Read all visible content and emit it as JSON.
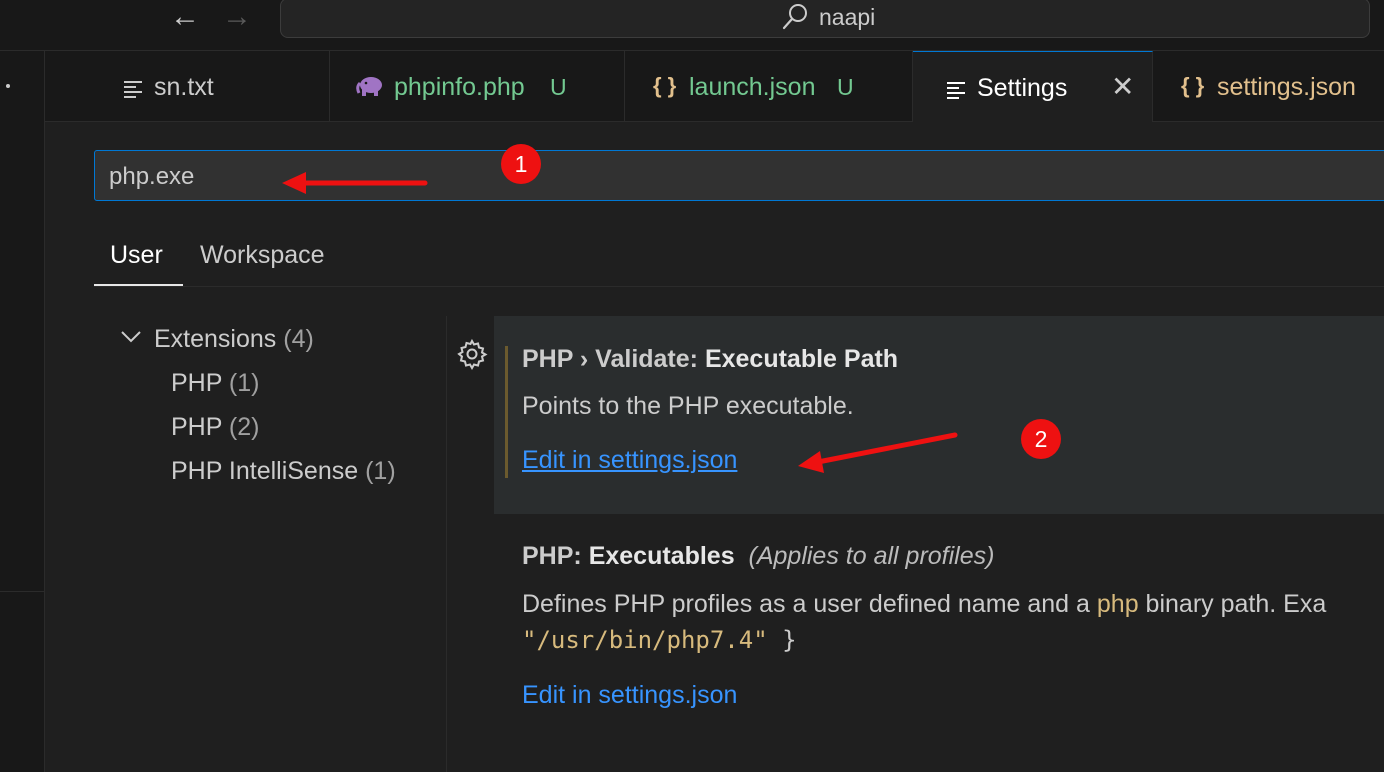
{
  "window": {
    "search_text": "naapi"
  },
  "tabs": [
    {
      "label": "sn.txt",
      "icon": "lines-icon",
      "color": "#cccccc"
    },
    {
      "label": "phpinfo.php",
      "badge": "U",
      "icon": "php-elephant-icon",
      "color": "#73c991"
    },
    {
      "label": "launch.json",
      "badge": "U",
      "icon": "{}",
      "color": "#73c991"
    },
    {
      "label": "Settings",
      "icon": "lines-icon",
      "color": "#ffffff",
      "active": true
    },
    {
      "label": "settings.json",
      "icon": "{}",
      "color": "#e2c08d"
    }
  ],
  "search": {
    "value": "php.exe"
  },
  "scope_tabs": {
    "user": "User",
    "workspace": "Workspace"
  },
  "toc": {
    "extensions": {
      "label": "Extensions",
      "count": "(4)"
    },
    "items": [
      {
        "label": "PHP",
        "count": "(1)"
      },
      {
        "label": "PHP",
        "count": "(2)"
      },
      {
        "label": "PHP IntelliSense",
        "count": "(1)"
      }
    ]
  },
  "settings": [
    {
      "category": "PHP › Validate: ",
      "name": "Executable Path",
      "description": "Points to the PHP executable.",
      "link": "Edit in settings.json"
    },
    {
      "category": "PHP: ",
      "name": "Executables",
      "note": "(Applies to all profiles)",
      "description_before": "Defines PHP profiles as a user defined name and a ",
      "description_keyword": "php",
      "description_after": " binary path. Exa",
      "code_value": "\"/usr/bin/php7.4\"",
      "code_brace": " }",
      "link": "Edit in settings.json"
    }
  ],
  "annotations": {
    "badge_1": "1",
    "badge_2": "2",
    "color": "#ee1111"
  }
}
